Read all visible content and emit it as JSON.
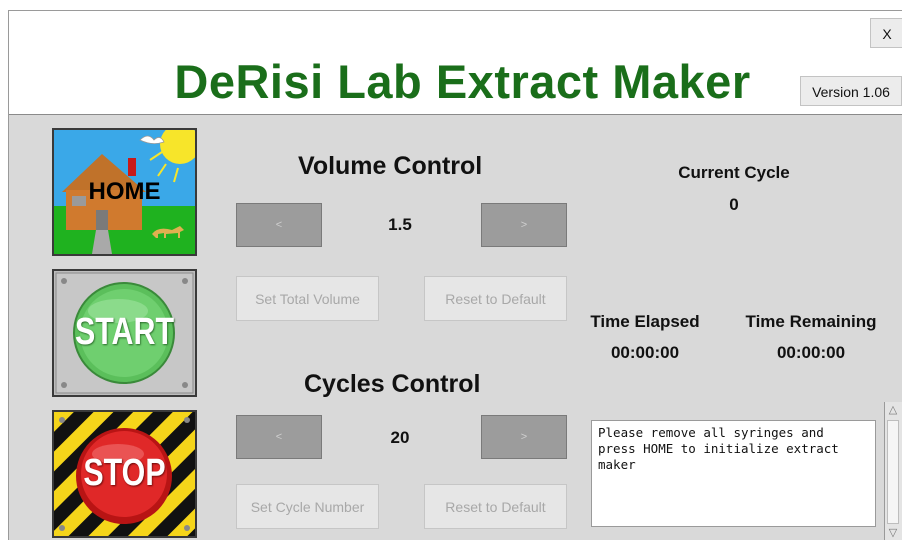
{
  "window": {
    "title": "DeRisi Lab Extract Maker",
    "close_label": "X",
    "version_label": "Version 1.06"
  },
  "side_buttons": {
    "home_label": "HOME",
    "start_label": "START",
    "stop_label": "STOP"
  },
  "volume": {
    "title": "Volume Control",
    "decrease_label": "<",
    "value": "1.5",
    "increase_label": ">",
    "set_label": "Set Total Volume",
    "reset_label": "Reset to Default"
  },
  "cycles": {
    "title": "Cycles Control",
    "decrease_label": "<",
    "value": "20",
    "increase_label": ">",
    "set_label": "Set Cycle Number",
    "reset_label": "Reset to Default"
  },
  "status": {
    "current_cycle_label": "Current Cycle",
    "current_cycle_value": "0",
    "time_elapsed_label": "Time Elapsed",
    "time_elapsed_value": "00:00:00",
    "time_remaining_label": "Time Remaining",
    "time_remaining_value": "00:00:00"
  },
  "message": {
    "text": "Please remove all syringes and\npress HOME to initialize extract\nmaker"
  },
  "colors": {
    "title_green": "#1a6e1a",
    "panel_bg": "#d9d9d9",
    "start_green": "#4caf50",
    "stop_red": "#d42020"
  }
}
